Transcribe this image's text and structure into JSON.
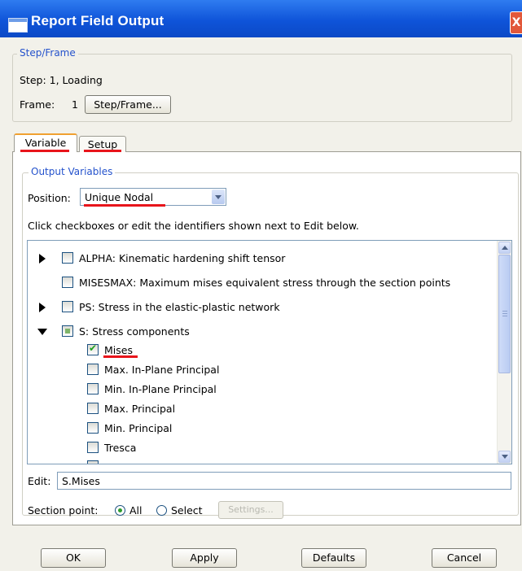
{
  "window": {
    "title": "Report Field Output",
    "close_glyph": "X"
  },
  "step_frame": {
    "legend": "Step/Frame",
    "step_text": "Step: 1, Loading",
    "frame_label": "Frame:",
    "frame_value": "1",
    "button_label": "Step/Frame..."
  },
  "tabs": [
    {
      "label": "Variable",
      "active": true
    },
    {
      "label": "Setup",
      "active": false
    }
  ],
  "output_variables": {
    "legend": "Output Variables",
    "position_label": "Position:",
    "position_value": "Unique Nodal",
    "instructions": "Click checkboxes or edit the identifiers shown next to Edit below.",
    "tree": [
      {
        "label": "ALPHA: Kinematic hardening shift tensor",
        "expander": "collapsed",
        "checked": false
      },
      {
        "label": "MISESMAX: Maximum mises equivalent stress through the section points",
        "expander": "none",
        "checked": false
      },
      {
        "label": "PS: Stress in the elastic-plastic network",
        "expander": "collapsed",
        "checked": false
      },
      {
        "label": "S: Stress components",
        "expander": "expanded",
        "checked": "partial"
      },
      {
        "label": "Mises",
        "checked": true
      },
      {
        "label": "Max. In-Plane Principal",
        "checked": false
      },
      {
        "label": "Min. In-Plane Principal",
        "checked": false
      },
      {
        "label": "Max. Principal",
        "checked": false
      },
      {
        "label": "Min. Principal",
        "checked": false
      },
      {
        "label": "Tresca",
        "checked": false
      }
    ],
    "edit_label": "Edit:",
    "edit_value": "S.Mises",
    "section_point_label": "Section point:",
    "radio_all": "All",
    "radio_select": "Select",
    "settings_button": "Settings..."
  },
  "buttons": {
    "ok": "OK",
    "apply": "Apply",
    "defaults": "Defaults",
    "cancel": "Cancel"
  },
  "colors": {
    "title_bar": "#0f54d9",
    "legend_text": "#2452cc",
    "annotation_underline": "#e8141b"
  }
}
